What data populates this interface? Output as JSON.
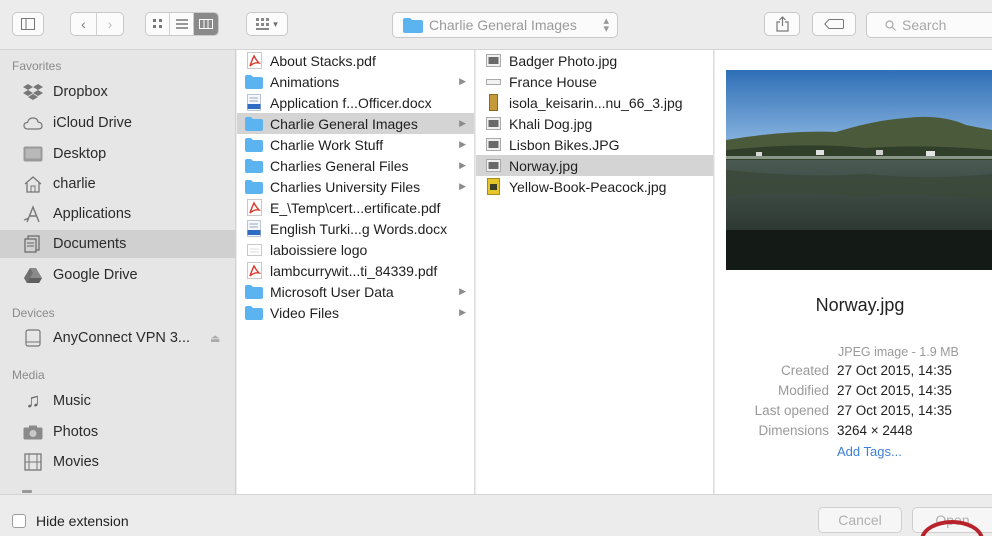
{
  "toolbar": {
    "location": "Charlie General Images",
    "search_placeholder": "Search"
  },
  "sidebar": {
    "favorites_header": "Favorites",
    "favorites": [
      {
        "label": "Dropbox",
        "icon": "dropbox-icon"
      },
      {
        "label": "iCloud Drive",
        "icon": "cloud-icon"
      },
      {
        "label": "Desktop",
        "icon": "desktop-icon"
      },
      {
        "label": "charlie",
        "icon": "home-icon"
      },
      {
        "label": "Applications",
        "icon": "applications-icon"
      },
      {
        "label": "Documents",
        "icon": "documents-icon",
        "selected": true
      },
      {
        "label": "Google Drive",
        "icon": "google-drive-icon"
      }
    ],
    "devices_header": "Devices",
    "devices": [
      {
        "label": "AnyConnect VPN 3...",
        "icon": "disk-icon"
      }
    ],
    "media_header": "Media",
    "media": [
      {
        "label": "Music",
        "icon": "music-icon"
      },
      {
        "label": "Photos",
        "icon": "camera-icon"
      },
      {
        "label": "Movies",
        "icon": "film-icon"
      }
    ]
  },
  "column1": [
    {
      "label": "About Stacks.pdf",
      "kind": "pdf"
    },
    {
      "label": "Animations",
      "kind": "folder"
    },
    {
      "label": "Application f...Officer.docx",
      "kind": "doc"
    },
    {
      "label": "Charlie General Images",
      "kind": "folder",
      "selected": true
    },
    {
      "label": "Charlie Work Stuff",
      "kind": "folder"
    },
    {
      "label": "Charlies General Files",
      "kind": "folder"
    },
    {
      "label": "Charlies University Files",
      "kind": "folder"
    },
    {
      "label": "E_\\Temp\\cert...ertificate.pdf",
      "kind": "pdf"
    },
    {
      "label": "English Turki...g Words.docx",
      "kind": "doc"
    },
    {
      "label": "laboissiere logo",
      "kind": "img"
    },
    {
      "label": "lambcurrywit...ti_84339.pdf",
      "kind": "pdf"
    },
    {
      "label": "Microsoft User Data",
      "kind": "folder"
    },
    {
      "label": "Video Files",
      "kind": "folder"
    }
  ],
  "column2": [
    {
      "label": "Badger Photo.jpg",
      "kind": "photo"
    },
    {
      "label": "France House",
      "kind": "plain"
    },
    {
      "label": "isola_keisarin...nu_66_3.jpg",
      "kind": "tall"
    },
    {
      "label": "Khali Dog.jpg",
      "kind": "photo"
    },
    {
      "label": "Lisbon Bikes.JPG",
      "kind": "photo"
    },
    {
      "label": "Norway.jpg",
      "kind": "photo",
      "selected": true
    },
    {
      "label": "Yellow-Book-Peacock.jpg",
      "kind": "yellow"
    }
  ],
  "preview": {
    "name": "Norway.jpg",
    "kind": "JPEG image - 1.9 MB",
    "created_label": "Created",
    "created": "27 Oct 2015, 14:35",
    "modified_label": "Modified",
    "modified": "27 Oct 2015, 14:35",
    "opened_label": "Last opened",
    "opened": "27 Oct 2015, 14:35",
    "dimensions_label": "Dimensions",
    "dimensions": "3264 × 2448",
    "add_tags": "Add Tags..."
  },
  "bottom": {
    "hide_extension": "Hide extension",
    "cancel": "Cancel",
    "open": "Open"
  },
  "colors": {
    "accent_link": "#3d7fd8",
    "folder_blue": "#5bb4ef",
    "pdf_red": "#d83a2e",
    "highlight_ring": "#b8222a"
  }
}
